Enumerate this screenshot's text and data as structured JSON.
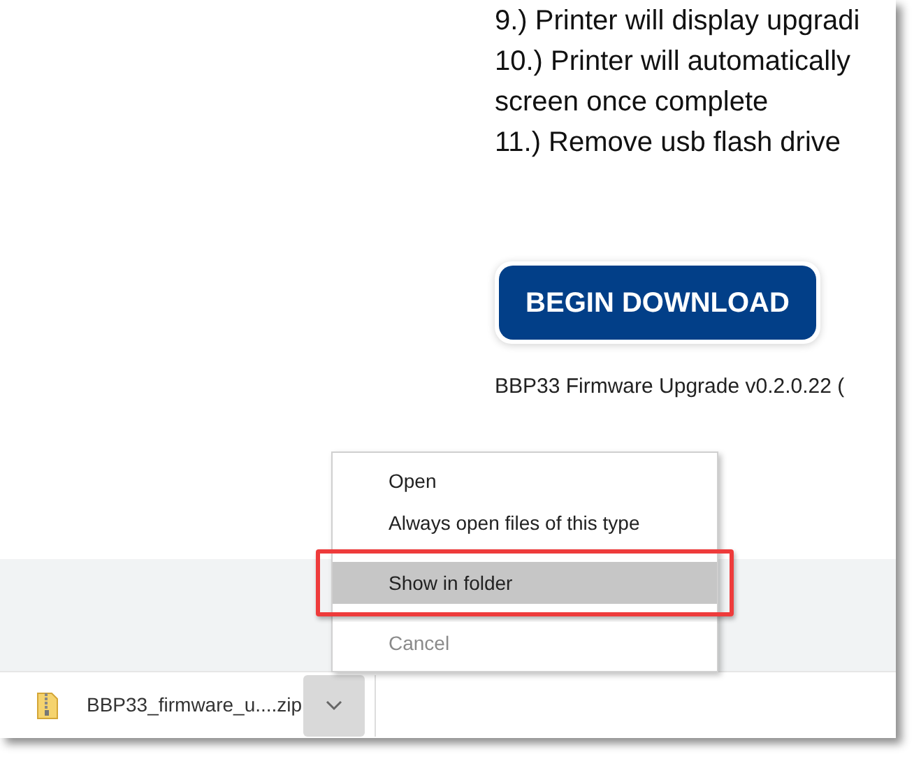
{
  "instructions": [
    "9.) Printer will display upgradi",
    "10.) Printer will automatically",
    "screen once complete",
    "11.) Remove usb flash drive"
  ],
  "download_button": {
    "label": "BEGIN DOWNLOAD"
  },
  "file_caption": "BBP33 Firmware Upgrade v0.2.0.22 (",
  "context_menu": {
    "items": [
      {
        "kind": "item",
        "label": "Open",
        "selected": false,
        "disabled": false,
        "annotated": false
      },
      {
        "kind": "item",
        "label": "Always open files of this type",
        "selected": false,
        "disabled": false,
        "annotated": false
      },
      {
        "kind": "separator"
      },
      {
        "kind": "item",
        "label": "Show in folder",
        "selected": true,
        "disabled": false,
        "annotated": true
      },
      {
        "kind": "separator"
      },
      {
        "kind": "item",
        "label": "Cancel",
        "selected": false,
        "disabled": true,
        "annotated": false
      }
    ]
  },
  "download_shelf": {
    "file_name": "BBP33_firmware_u....zip",
    "menu_open": true
  }
}
